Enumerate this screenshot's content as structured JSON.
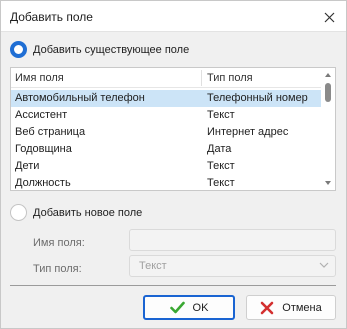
{
  "window": {
    "title": "Добавить поле",
    "close_icon": "close-icon"
  },
  "options": {
    "existing": {
      "label": "Добавить существующее поле",
      "checked": true
    },
    "new": {
      "label": "Добавить новое поле",
      "checked": false
    }
  },
  "fields_list": {
    "columns": [
      "Имя поля",
      "Тип поля"
    ],
    "rows": [
      {
        "name": "Автомобильный телефон",
        "type": "Телефонный номер",
        "selected": true
      },
      {
        "name": "Ассистент",
        "type": "Текст",
        "selected": false
      },
      {
        "name": "Веб страница",
        "type": "Интернет адрес",
        "selected": false
      },
      {
        "name": "Годовщина",
        "type": "Дата",
        "selected": false
      },
      {
        "name": "Дети",
        "type": "Текст",
        "selected": false
      },
      {
        "name": "Должность",
        "type": "Текст",
        "selected": false
      }
    ]
  },
  "new_field": {
    "name_label": "Имя поля:",
    "name_value": "",
    "type_label": "Тип поля:",
    "type_value": "Текст",
    "chevron_icon": "chevron-down-icon"
  },
  "buttons": {
    "ok": {
      "label": "OK",
      "icon": "check-icon"
    },
    "cancel": {
      "label": "Отмена",
      "icon": "cross-icon"
    }
  },
  "colors": {
    "accent": "#1f6ed4",
    "selection": "#cce4f7",
    "ok_check": "#3aa832",
    "cancel_cross": "#d32f2f"
  }
}
